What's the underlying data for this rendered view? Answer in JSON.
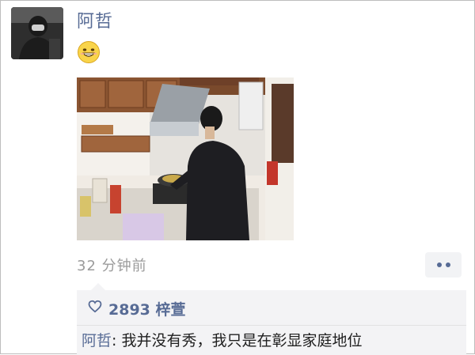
{
  "post": {
    "author_name": "阿哲",
    "emoji": "grin-emoji",
    "photo": "kitchen-cooking-photo",
    "timestamp": "32 分钟前"
  },
  "actions": {
    "more_icon": "two-dots-icon"
  },
  "likes": {
    "icon": "heart-icon",
    "text": "2893 梓萱"
  },
  "comment": {
    "author": "阿哲",
    "separator": ":",
    "text": "我并没有秀，我只是在彰显家庭地位"
  },
  "colors": {
    "name_link": "#576b95",
    "timestamp": "#9b9b9b",
    "comment_bg": "#f3f3f5"
  }
}
